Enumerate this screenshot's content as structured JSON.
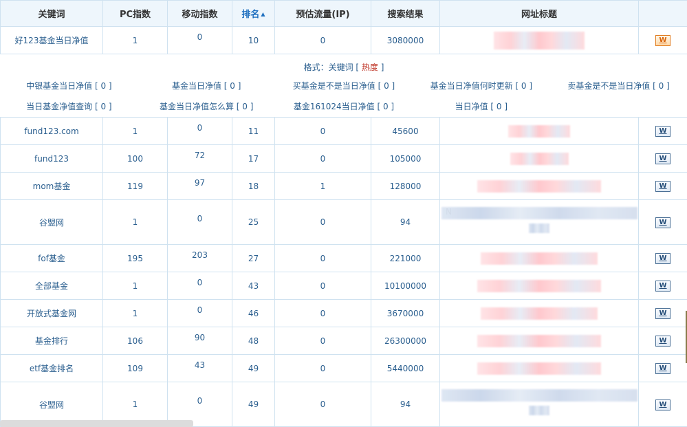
{
  "columns": {
    "keyword": "关键词",
    "pc_index": "PC指数",
    "mobile_index": "移动指数",
    "rank": "排名",
    "rank_sort_arrow": "▲",
    "traffic": "预估流量(IP)",
    "results": "搜索结果",
    "title": "网址标题"
  },
  "first_row": {
    "keyword": "好123基金当日净值",
    "pc": "1",
    "mobile": "0",
    "rank": "10",
    "traffic": "0",
    "results": "3080000",
    "action_label": "W"
  },
  "related": {
    "format_prefix": "格式：关键词 [ ",
    "format_heat": "热度",
    "format_suffix": " ]",
    "row1": [
      "中银基金当日净值 [ 0 ]",
      "基金当日净值 [ 0 ]",
      "买基金是不是当日净值 [ 0 ]",
      "基金当日净值何时更新 [ 0 ]",
      "卖基金是不是当日净值 [ 0 ]"
    ],
    "row2": [
      "当日基金净值查询 [ 0 ]",
      "基金当日净值怎么算 [ 0 ]",
      "基金161024当日净值 [ 0 ]",
      "当日净值 [ 0 ]",
      ""
    ]
  },
  "rows": [
    {
      "keyword": "fund123.com",
      "pc": "1",
      "mobile": "0",
      "rank": "11",
      "traffic": "0",
      "results": "45600",
      "action_label": "W"
    },
    {
      "keyword": "fund123",
      "pc": "100",
      "mobile": "72",
      "rank": "17",
      "traffic": "0",
      "results": "105000",
      "action_label": "W"
    },
    {
      "keyword": "mom基金",
      "pc": "119",
      "mobile": "97",
      "rank": "18",
      "traffic": "1",
      "results": "128000",
      "action_label": "W"
    },
    {
      "keyword": "谷盟网",
      "pc": "1",
      "mobile": "0",
      "rank": "25",
      "traffic": "0",
      "results": "94",
      "action_label": "W",
      "title_prefix": "N"
    },
    {
      "keyword": "fof基金",
      "pc": "195",
      "mobile": "203",
      "rank": "27",
      "traffic": "0",
      "results": "221000",
      "action_label": "W"
    },
    {
      "keyword": "全部基金",
      "pc": "1",
      "mobile": "0",
      "rank": "43",
      "traffic": "0",
      "results": "10100000",
      "action_label": "W"
    },
    {
      "keyword": "开放式基金网",
      "pc": "1",
      "mobile": "0",
      "rank": "46",
      "traffic": "0",
      "results": "3670000",
      "action_label": "W"
    },
    {
      "keyword": "基金排行",
      "pc": "106",
      "mobile": "90",
      "rank": "48",
      "traffic": "0",
      "results": "26300000",
      "action_label": "W"
    },
    {
      "keyword": "etf基金排名",
      "pc": "109",
      "mobile": "43",
      "rank": "49",
      "traffic": "0",
      "results": "5440000",
      "action_label": "W"
    },
    {
      "keyword": "谷盟网",
      "pc": "1",
      "mobile": "0",
      "rank": "49",
      "traffic": "0",
      "results": "94",
      "action_label": "W"
    }
  ]
}
